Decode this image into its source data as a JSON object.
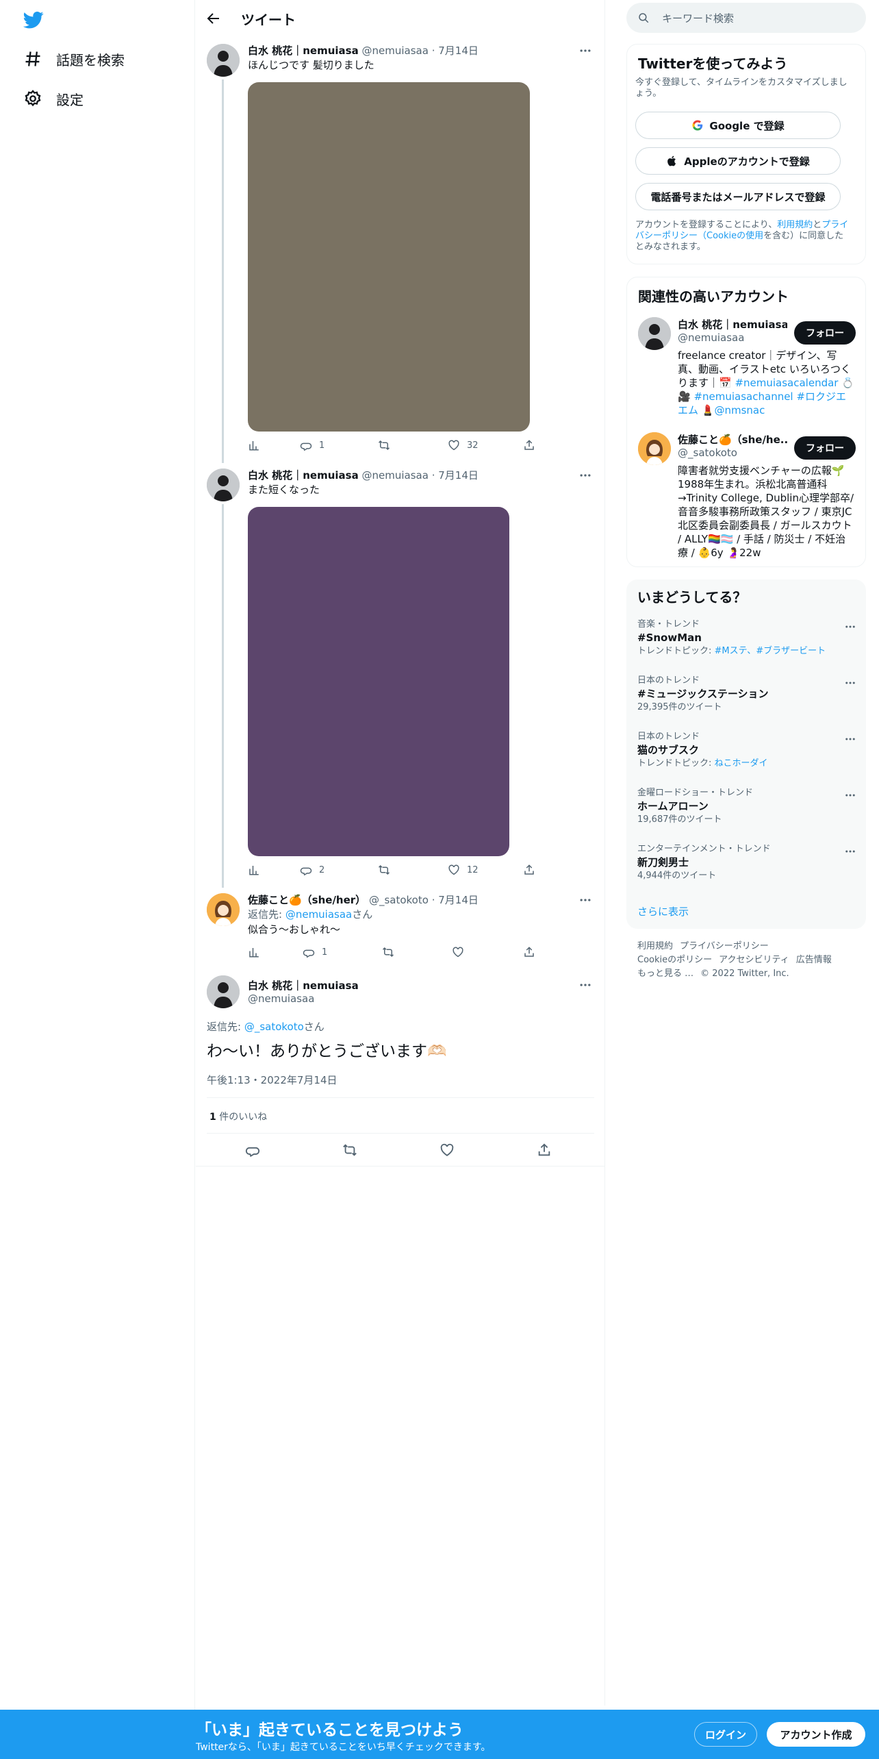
{
  "nav": {
    "explore_label": "話題を検索",
    "settings_label": "設定"
  },
  "header": {
    "title": "ツイート"
  },
  "thread": [
    {
      "name": "白水 桃花｜nemuiasa",
      "handle": "@nemuiasaa",
      "date": "7月14日",
      "text": "ほんじつです 髪切りました",
      "media_color": "#7a7262",
      "replies": "1",
      "retweets": "",
      "likes": "32"
    },
    {
      "name": "白水 桃花｜nemuiasa",
      "handle": "@nemuiasaa",
      "date": "7月14日",
      "text": "また短くなった",
      "media_color": "#5c456c",
      "replies": "2",
      "retweets": "",
      "likes": "12"
    },
    {
      "name": "佐藤こと🍊（she/her）",
      "handle": "@_satokoto",
      "date": "7月14日",
      "reply_prefix": "返信先: ",
      "reply_to": "@nemuiasaa",
      "reply_suffix": "さん",
      "text": "似合う〜おしゃれ〜",
      "replies": "1",
      "retweets": "",
      "likes": ""
    }
  ],
  "focused": {
    "name": "白水 桃花｜nemuiasa",
    "handle": "@nemuiasaa",
    "reply_prefix": "返信先: ",
    "reply_to": "@_satokoto",
    "reply_suffix": "さん",
    "text": "わ〜い！ありがとうございます🫶🏻",
    "timestamp": "午後1:13・2022年7月14日",
    "likes_count": "1",
    "likes_label": " 件のいいね"
  },
  "right": {
    "search_placeholder": "キーワード検索",
    "signup": {
      "title": "Twitterを使ってみよう",
      "subtitle": "今すぐ登録して、タイムラインをカスタマイズしましょう。",
      "google_btn": "Google で登録",
      "apple_btn": "Appleのアカウントで登録",
      "phone_btn": "電話番号またはメールアドレスで登録",
      "terms_1": "アカウントを登録することにより、",
      "terms_link1": "利用規約",
      "terms_2": "と",
      "terms_link2": "プライバシーポリシー（Cookieの使用",
      "terms_3": "を含む）に同意したとみなされます。"
    },
    "relevant": {
      "title": "関連性の高いアカウント",
      "follow_label": "フォロー",
      "accounts": [
        {
          "name": "白水 桃花｜nemuiasa",
          "handle": "@nemuiasaa",
          "bio_1": "freelance creator｜デザイン、写真、動画、イラストetc いろいろつくります｜📅 ",
          "bio_link1": "#nemuiasacalendar",
          "bio_2": " 💍 🎥 ",
          "bio_link2": "#nemuiasachannel",
          "bio_3": " ",
          "bio_link3": "#ロクジエエム",
          "bio_4": " 💄",
          "bio_link4": "@nmsnac"
        },
        {
          "name": "佐藤こと🍊（she/he...",
          "handle": "@_satokoto",
          "bio": "障害者就労支援ベンチャーの広報🌱1988年生まれ。浜松北高普通科→Trinity College, Dublin心理学部卒/音音多駿事務所政策スタッフ / 東京JC北区委員会副委員長 / ガールスカウト / ALLY🏳️‍🌈🏳️‍⚧️ / 手話 / 防災士 / 不妊治療 / 👶6y 🤰22w"
        }
      ]
    },
    "trends": {
      "title": "いまどうしてる？",
      "items": [
        {
          "category": "音楽・トレンド",
          "name": "#SnowMan",
          "sub_label": "トレンドトピック: ",
          "sub_links": "#Mステ、#ブラザービート"
        },
        {
          "category": "日本のトレンド",
          "name": "#ミュージックステーション",
          "sub": "29,395件のツイート"
        },
        {
          "category": "日本のトレンド",
          "name": "猫のサブスク",
          "sub_label": "トレンドトピック: ",
          "sub_links": "ねこホーダイ"
        },
        {
          "category": "金曜ロードショー・トレンド",
          "name": "ホームアローン",
          "sub": "19,687件のツイート"
        },
        {
          "category": "エンターテインメント・トレンド",
          "name": "新刀剣男士",
          "sub": "4,944件のツイート"
        }
      ],
      "show_more": "さらに表示"
    },
    "footer": {
      "line1": [
        "利用規約",
        "プライバシーポリシー"
      ],
      "line2": [
        "Cookieのポリシー",
        "アクセシビリティ",
        "広告情報"
      ],
      "line3": [
        "もっと見る …",
        "© 2022 Twitter, Inc."
      ]
    }
  },
  "bottombar": {
    "title": "「いま」起きていることを見つけよう",
    "subtitle": "Twitterなら、「いま」起きていることをいち早くチェックできます。",
    "login": "ログイン",
    "signup": "アカウント作成"
  },
  "colors": {
    "accent": "#1d9bf0",
    "text": "#0f1419",
    "secondary": "#536471"
  }
}
